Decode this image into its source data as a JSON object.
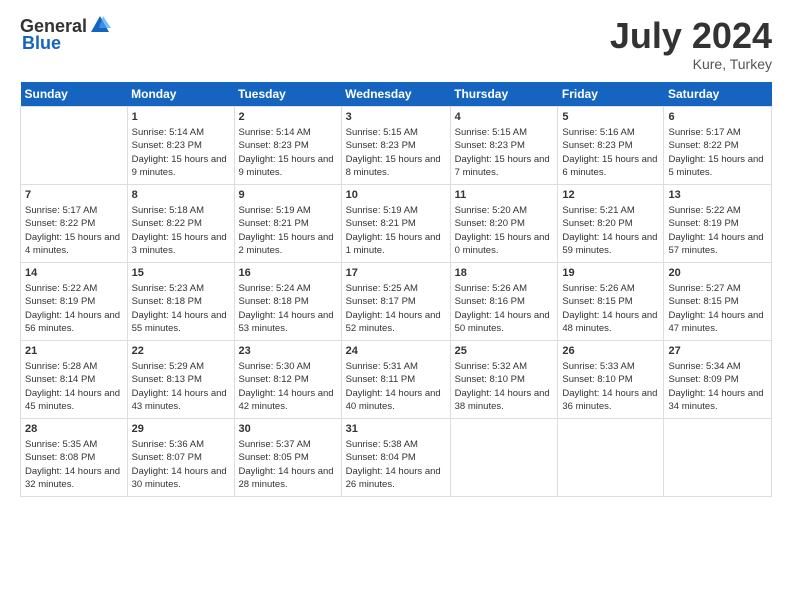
{
  "header": {
    "logo_general": "General",
    "logo_blue": "Blue",
    "month_year": "July 2024",
    "location": "Kure, Turkey"
  },
  "calendar": {
    "days_of_week": [
      "Sunday",
      "Monday",
      "Tuesday",
      "Wednesday",
      "Thursday",
      "Friday",
      "Saturday"
    ],
    "weeks": [
      [
        {
          "day": "",
          "sunrise": "",
          "sunset": "",
          "daylight": ""
        },
        {
          "day": "1",
          "sunrise": "Sunrise: 5:14 AM",
          "sunset": "Sunset: 8:23 PM",
          "daylight": "Daylight: 15 hours and 9 minutes."
        },
        {
          "day": "2",
          "sunrise": "Sunrise: 5:14 AM",
          "sunset": "Sunset: 8:23 PM",
          "daylight": "Daylight: 15 hours and 9 minutes."
        },
        {
          "day": "3",
          "sunrise": "Sunrise: 5:15 AM",
          "sunset": "Sunset: 8:23 PM",
          "daylight": "Daylight: 15 hours and 8 minutes."
        },
        {
          "day": "4",
          "sunrise": "Sunrise: 5:15 AM",
          "sunset": "Sunset: 8:23 PM",
          "daylight": "Daylight: 15 hours and 7 minutes."
        },
        {
          "day": "5",
          "sunrise": "Sunrise: 5:16 AM",
          "sunset": "Sunset: 8:23 PM",
          "daylight": "Daylight: 15 hours and 6 minutes."
        },
        {
          "day": "6",
          "sunrise": "Sunrise: 5:17 AM",
          "sunset": "Sunset: 8:22 PM",
          "daylight": "Daylight: 15 hours and 5 minutes."
        }
      ],
      [
        {
          "day": "7",
          "sunrise": "Sunrise: 5:17 AM",
          "sunset": "Sunset: 8:22 PM",
          "daylight": "Daylight: 15 hours and 4 minutes."
        },
        {
          "day": "8",
          "sunrise": "Sunrise: 5:18 AM",
          "sunset": "Sunset: 8:22 PM",
          "daylight": "Daylight: 15 hours and 3 minutes."
        },
        {
          "day": "9",
          "sunrise": "Sunrise: 5:19 AM",
          "sunset": "Sunset: 8:21 PM",
          "daylight": "Daylight: 15 hours and 2 minutes."
        },
        {
          "day": "10",
          "sunrise": "Sunrise: 5:19 AM",
          "sunset": "Sunset: 8:21 PM",
          "daylight": "Daylight: 15 hours and 1 minute."
        },
        {
          "day": "11",
          "sunrise": "Sunrise: 5:20 AM",
          "sunset": "Sunset: 8:20 PM",
          "daylight": "Daylight: 15 hours and 0 minutes."
        },
        {
          "day": "12",
          "sunrise": "Sunrise: 5:21 AM",
          "sunset": "Sunset: 8:20 PM",
          "daylight": "Daylight: 14 hours and 59 minutes."
        },
        {
          "day": "13",
          "sunrise": "Sunrise: 5:22 AM",
          "sunset": "Sunset: 8:19 PM",
          "daylight": "Daylight: 14 hours and 57 minutes."
        }
      ],
      [
        {
          "day": "14",
          "sunrise": "Sunrise: 5:22 AM",
          "sunset": "Sunset: 8:19 PM",
          "daylight": "Daylight: 14 hours and 56 minutes."
        },
        {
          "day": "15",
          "sunrise": "Sunrise: 5:23 AM",
          "sunset": "Sunset: 8:18 PM",
          "daylight": "Daylight: 14 hours and 55 minutes."
        },
        {
          "day": "16",
          "sunrise": "Sunrise: 5:24 AM",
          "sunset": "Sunset: 8:18 PM",
          "daylight": "Daylight: 14 hours and 53 minutes."
        },
        {
          "day": "17",
          "sunrise": "Sunrise: 5:25 AM",
          "sunset": "Sunset: 8:17 PM",
          "daylight": "Daylight: 14 hours and 52 minutes."
        },
        {
          "day": "18",
          "sunrise": "Sunrise: 5:26 AM",
          "sunset": "Sunset: 8:16 PM",
          "daylight": "Daylight: 14 hours and 50 minutes."
        },
        {
          "day": "19",
          "sunrise": "Sunrise: 5:26 AM",
          "sunset": "Sunset: 8:15 PM",
          "daylight": "Daylight: 14 hours and 48 minutes."
        },
        {
          "day": "20",
          "sunrise": "Sunrise: 5:27 AM",
          "sunset": "Sunset: 8:15 PM",
          "daylight": "Daylight: 14 hours and 47 minutes."
        }
      ],
      [
        {
          "day": "21",
          "sunrise": "Sunrise: 5:28 AM",
          "sunset": "Sunset: 8:14 PM",
          "daylight": "Daylight: 14 hours and 45 minutes."
        },
        {
          "day": "22",
          "sunrise": "Sunrise: 5:29 AM",
          "sunset": "Sunset: 8:13 PM",
          "daylight": "Daylight: 14 hours and 43 minutes."
        },
        {
          "day": "23",
          "sunrise": "Sunrise: 5:30 AM",
          "sunset": "Sunset: 8:12 PM",
          "daylight": "Daylight: 14 hours and 42 minutes."
        },
        {
          "day": "24",
          "sunrise": "Sunrise: 5:31 AM",
          "sunset": "Sunset: 8:11 PM",
          "daylight": "Daylight: 14 hours and 40 minutes."
        },
        {
          "day": "25",
          "sunrise": "Sunrise: 5:32 AM",
          "sunset": "Sunset: 8:10 PM",
          "daylight": "Daylight: 14 hours and 38 minutes."
        },
        {
          "day": "26",
          "sunrise": "Sunrise: 5:33 AM",
          "sunset": "Sunset: 8:10 PM",
          "daylight": "Daylight: 14 hours and 36 minutes."
        },
        {
          "day": "27",
          "sunrise": "Sunrise: 5:34 AM",
          "sunset": "Sunset: 8:09 PM",
          "daylight": "Daylight: 14 hours and 34 minutes."
        }
      ],
      [
        {
          "day": "28",
          "sunrise": "Sunrise: 5:35 AM",
          "sunset": "Sunset: 8:08 PM",
          "daylight": "Daylight: 14 hours and 32 minutes."
        },
        {
          "day": "29",
          "sunrise": "Sunrise: 5:36 AM",
          "sunset": "Sunset: 8:07 PM",
          "daylight": "Daylight: 14 hours and 30 minutes."
        },
        {
          "day": "30",
          "sunrise": "Sunrise: 5:37 AM",
          "sunset": "Sunset: 8:05 PM",
          "daylight": "Daylight: 14 hours and 28 minutes."
        },
        {
          "day": "31",
          "sunrise": "Sunrise: 5:38 AM",
          "sunset": "Sunset: 8:04 PM",
          "daylight": "Daylight: 14 hours and 26 minutes."
        },
        {
          "day": "",
          "sunrise": "",
          "sunset": "",
          "daylight": ""
        },
        {
          "day": "",
          "sunrise": "",
          "sunset": "",
          "daylight": ""
        },
        {
          "day": "",
          "sunrise": "",
          "sunset": "",
          "daylight": ""
        }
      ]
    ]
  }
}
